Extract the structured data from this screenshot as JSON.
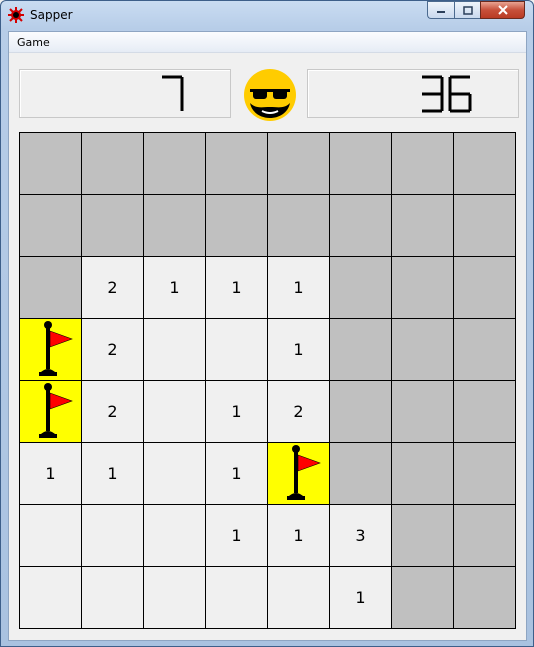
{
  "window": {
    "title": "Sapper"
  },
  "menu": {
    "items": [
      "Game"
    ]
  },
  "counters": {
    "mines_left": "7",
    "timer": "36"
  },
  "face": {
    "icon": "sunglasses-bearded-smiley-icon",
    "color": "#ffcc00"
  },
  "colors": {
    "hidden": "#c0c0c0",
    "open": "#f0f0f0",
    "flag": "#ffff00",
    "flag_red": "#ff0000"
  },
  "board": {
    "rows": [
      [
        "H",
        "H",
        "H",
        "H",
        "H",
        "H",
        "H",
        "H"
      ],
      [
        "H",
        "H",
        "H",
        "H",
        "H",
        "H",
        "H",
        "H"
      ],
      [
        "H",
        "2",
        "1",
        "1",
        "1",
        "H",
        "H",
        "H"
      ],
      [
        "F",
        "2",
        "",
        "",
        "1",
        "H",
        "H",
        "H"
      ],
      [
        "F",
        "2",
        "",
        "1",
        "2",
        "H",
        "H",
        "H"
      ],
      [
        "1",
        "1",
        "",
        "1",
        "F",
        "H",
        "H",
        "H"
      ],
      [
        "",
        "",
        "",
        "1",
        "1",
        "3",
        "H",
        "H"
      ],
      [
        "",
        "",
        "",
        "",
        "",
        "1",
        "H",
        "H"
      ]
    ]
  }
}
